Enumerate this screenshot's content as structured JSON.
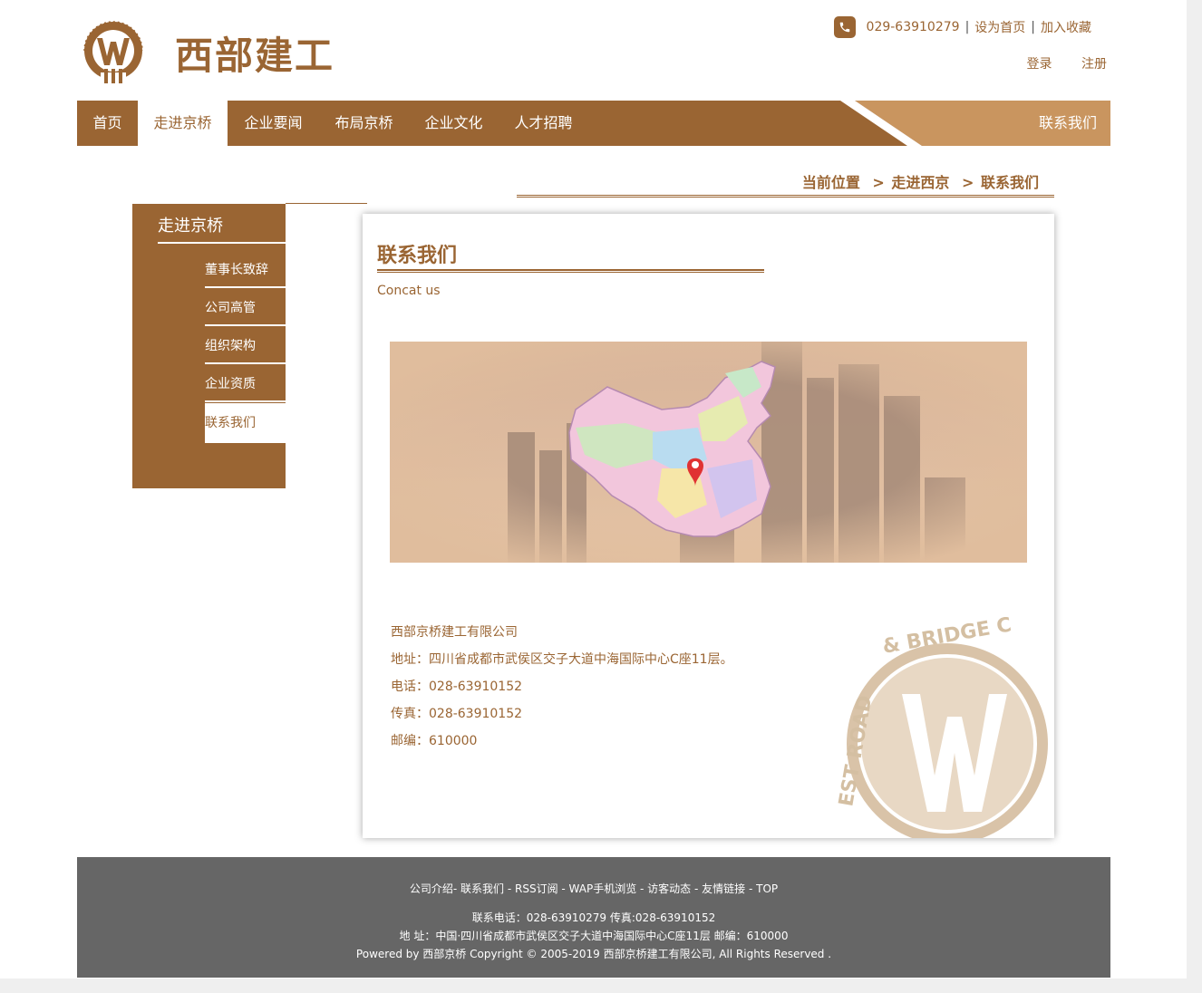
{
  "header": {
    "logo_text": "西部建工",
    "logo_ring_text": "WEST ROAD & BRIDGE CONSTRUCTION",
    "phone": "029-63910279",
    "set_home": "设为首页",
    "add_favorite": "加入收藏",
    "separator": "|",
    "login": "登录",
    "register": "注册"
  },
  "nav": {
    "items": [
      "首页",
      "走进京桥",
      "企业要闻",
      "布局京桥",
      "企业文化",
      "人才招聘"
    ],
    "active_index": 1,
    "contact": "联系我们"
  },
  "breadcrumb": {
    "label": "当前位置",
    "sep": ">",
    "level1": "走进西京",
    "level2": "联系我们"
  },
  "sidebar": {
    "title": "走进京桥",
    "items": [
      "董事长致辞",
      "公司高管",
      "组织架构",
      "企业资质",
      "联系我们"
    ],
    "active_index": 4
  },
  "main": {
    "title": "联系我们",
    "subtitle": "Concat us",
    "company": "西部京桥建工有限公司",
    "address": "地址：四川省成都市武侯区交子大道中海国际中心C座11层。",
    "phone": "电话：028-63910152",
    "fax": "传真：028-63910152",
    "postcode": "邮编：610000"
  },
  "footer": {
    "links": [
      "公司介绍",
      "联系我们",
      "RSS订阅",
      "WAP手机浏览",
      "访客动态",
      "友情链接",
      "TOP"
    ],
    "contact_line": "联系电话：028-63910279 传真:028-63910152",
    "address_line": "地 址：中国·四川省成都市武侯区交子大道中海国际中心C座11层 邮编：610000",
    "copyright_line": "Powered by 西部京桥 Copyright © 2005-2019 西部京桥建工有限公司, All Rights Reserved ."
  },
  "colors": {
    "brand": "#9a6533",
    "brand_light": "#c9955f",
    "footer_bg": "#666666"
  }
}
